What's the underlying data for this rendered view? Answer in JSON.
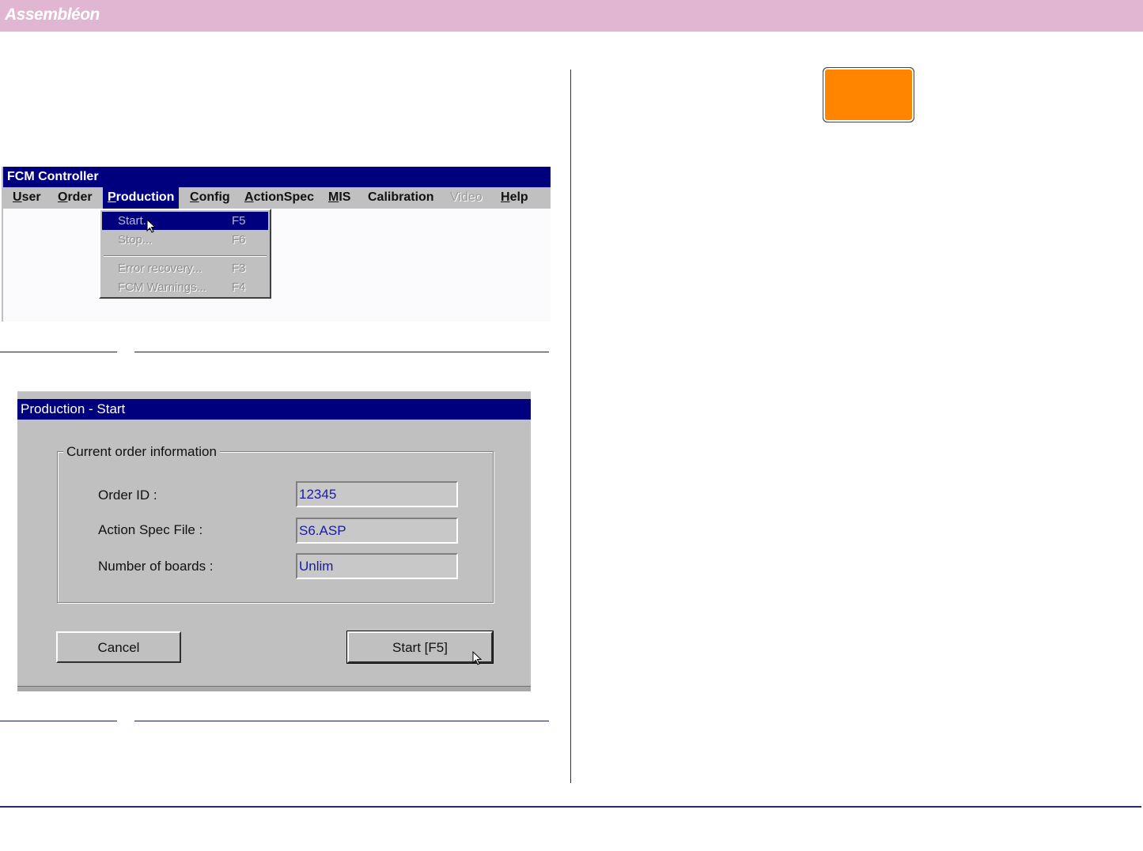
{
  "header": {
    "brand": "Assembléon"
  },
  "fcm_window": {
    "title": "FCM Controller",
    "menu": [
      {
        "label": "User",
        "mnemonic": "U",
        "rest": "ser",
        "state": "normal"
      },
      {
        "label": "Order",
        "mnemonic": "O",
        "rest": "rder",
        "state": "normal"
      },
      {
        "label": "Production",
        "mnemonic": "P",
        "rest": "roduction",
        "state": "active"
      },
      {
        "label": "Config",
        "mnemonic": "C",
        "rest": "onfig",
        "state": "normal"
      },
      {
        "label": "ActionSpec",
        "mnemonic": "A",
        "rest": "ctionSpec",
        "state": "normal"
      },
      {
        "label": "MIS",
        "mnemonic": "M",
        "rest": "IS",
        "state": "normal"
      },
      {
        "label": "Calibration",
        "mnemonic": "",
        "rest": "Calibration",
        "state": "normal"
      },
      {
        "label": "Video",
        "mnemonic": "",
        "rest": "Video",
        "state": "disabled"
      },
      {
        "label": "Help",
        "mnemonic": "H",
        "rest": "elp",
        "state": "normal"
      }
    ],
    "dropdown": [
      {
        "label": "Start...",
        "shortcut": "F5",
        "highlighted": true
      },
      {
        "label": "Stop...",
        "shortcut": "F6",
        "highlighted": false
      },
      {
        "label": "Error recovery...",
        "shortcut": "F3",
        "highlighted": false
      },
      {
        "label": "FCM Warnings...",
        "shortcut": "F4",
        "highlighted": false
      }
    ]
  },
  "start_dialog": {
    "title": "Production - Start",
    "group_label": "Current order information",
    "fields": [
      {
        "label": "Order ID :",
        "value": "12345"
      },
      {
        "label": "Action Spec File :",
        "value": "S6.ASP"
      },
      {
        "label": "Number of boards :",
        "value": "Unlim"
      }
    ],
    "cancel_label": "Cancel",
    "start_label": "Start [F5]"
  },
  "indicator": {
    "color": "#ff8400"
  },
  "colors": {
    "header_band": "#e1b6d2",
    "title_bar": "#00007f",
    "dialog_face": "#c0c0c0",
    "rules": "#1a1a4e"
  }
}
